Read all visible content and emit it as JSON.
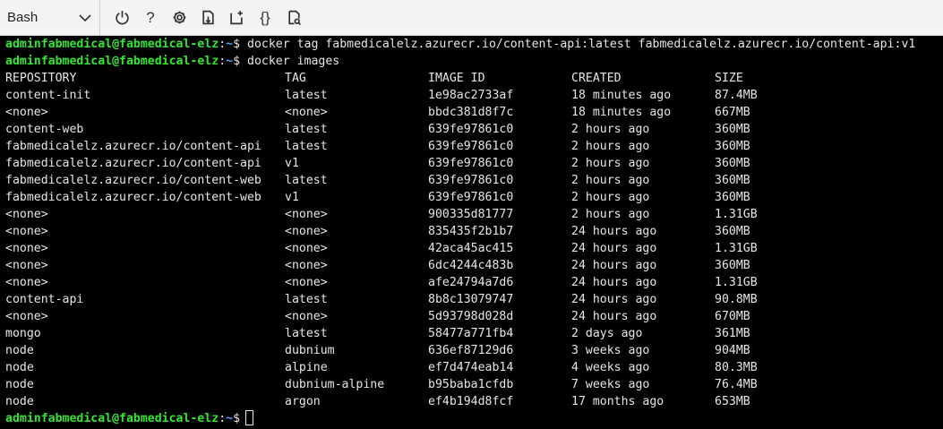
{
  "toolbar": {
    "shell": "Bash",
    "icons": [
      "chevron-down-icon",
      "power-icon",
      "help-icon",
      "settings-icon",
      "upload-download-icon",
      "new-session-icon",
      "braces-icon",
      "web-preview-icon"
    ],
    "help_glyph": "?",
    "braces_glyph": "{}"
  },
  "prompt": {
    "user": "adminfabmedical@fabmedical-elz",
    "sep": ":",
    "path": "~",
    "symbol": "$"
  },
  "commands": [
    "docker tag fabmedicalelz.azurecr.io/content-api:latest fabmedicalelz.azurecr.io/content-api:v1",
    "docker images"
  ],
  "table": {
    "headers": {
      "repository": "REPOSITORY",
      "tag": "TAG",
      "image_id": "IMAGE ID",
      "created": "CREATED",
      "size": "SIZE"
    },
    "rows": [
      {
        "repository": "content-init",
        "tag": "latest",
        "image_id": "1e98ac2733af",
        "created": "18 minutes ago",
        "size": "87.4MB"
      },
      {
        "repository": "<none>",
        "tag": "<none>",
        "image_id": "bbdc381d8f7c",
        "created": "18 minutes ago",
        "size": "667MB"
      },
      {
        "repository": "content-web",
        "tag": "latest",
        "image_id": "639fe97861c0",
        "created": "2 hours ago",
        "size": "360MB"
      },
      {
        "repository": "fabmedicalelz.azurecr.io/content-api",
        "tag": "latest",
        "image_id": "639fe97861c0",
        "created": "2 hours ago",
        "size": "360MB"
      },
      {
        "repository": "fabmedicalelz.azurecr.io/content-api",
        "tag": "v1",
        "image_id": "639fe97861c0",
        "created": "2 hours ago",
        "size": "360MB"
      },
      {
        "repository": "fabmedicalelz.azurecr.io/content-web",
        "tag": "latest",
        "image_id": "639fe97861c0",
        "created": "2 hours ago",
        "size": "360MB"
      },
      {
        "repository": "fabmedicalelz.azurecr.io/content-web",
        "tag": "v1",
        "image_id": "639fe97861c0",
        "created": "2 hours ago",
        "size": "360MB"
      },
      {
        "repository": "<none>",
        "tag": "<none>",
        "image_id": "900335d81777",
        "created": "2 hours ago",
        "size": "1.31GB"
      },
      {
        "repository": "<none>",
        "tag": "<none>",
        "image_id": "835435f2b1b7",
        "created": "24 hours ago",
        "size": "360MB"
      },
      {
        "repository": "<none>",
        "tag": "<none>",
        "image_id": "42aca45ac415",
        "created": "24 hours ago",
        "size": "1.31GB"
      },
      {
        "repository": "<none>",
        "tag": "<none>",
        "image_id": "6dc4244c483b",
        "created": "24 hours ago",
        "size": "360MB"
      },
      {
        "repository": "<none>",
        "tag": "<none>",
        "image_id": "afe24794a7d6",
        "created": "24 hours ago",
        "size": "1.31GB"
      },
      {
        "repository": "content-api",
        "tag": "latest",
        "image_id": "8b8c13079747",
        "created": "24 hours ago",
        "size": "90.8MB"
      },
      {
        "repository": "<none>",
        "tag": "<none>",
        "image_id": "5d93798d028d",
        "created": "24 hours ago",
        "size": "670MB"
      },
      {
        "repository": "mongo",
        "tag": "latest",
        "image_id": "58477a771fb4",
        "created": "2 days ago",
        "size": "361MB"
      },
      {
        "repository": "node",
        "tag": "dubnium",
        "image_id": "636ef87129d6",
        "created": "3 weeks ago",
        "size": "904MB"
      },
      {
        "repository": "node",
        "tag": "alpine",
        "image_id": "ef7d474eab14",
        "created": "4 weeks ago",
        "size": "80.3MB"
      },
      {
        "repository": "node",
        "tag": "dubnium-alpine",
        "image_id": "b95baba1cfdb",
        "created": "7 weeks ago",
        "size": "76.4MB"
      },
      {
        "repository": "node",
        "tag": "argon",
        "image_id": "ef4b194d8fcf",
        "created": "17 months ago",
        "size": "653MB"
      }
    ]
  },
  "colors": {
    "prompt_user": "#34e534",
    "prompt_path": "#5aa0ff",
    "terminal_bg": "#000000",
    "terminal_fg": "#e6e6e6",
    "toolbar_bg": "#f3f3f3"
  }
}
